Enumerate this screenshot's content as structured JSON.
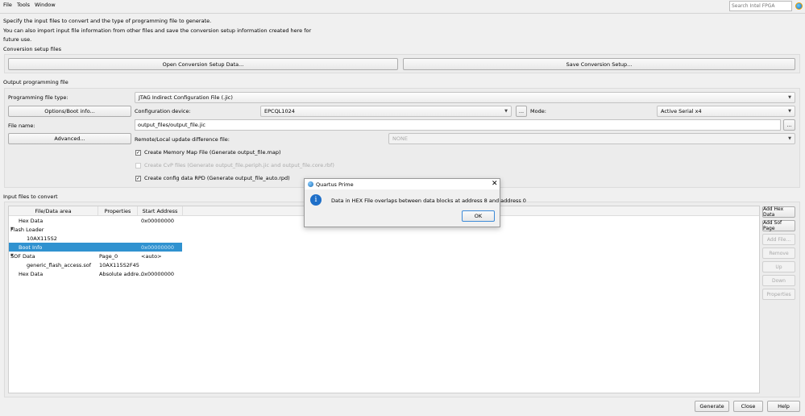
{
  "menu": [
    "File",
    "Tools",
    "Window"
  ],
  "search": {
    "placeholder": "Search Intel FPGA"
  },
  "intro": [
    "Specify the input files to convert and the type of programming file to generate.",
    "You can also import input file information from other files and save the conversion setup information created here for",
    "future use."
  ],
  "conversion_setup": {
    "title": "Conversion setup files",
    "open_label": "Open Conversion Setup Data...",
    "save_label": "Save Conversion Setup..."
  },
  "output": {
    "title": "Output programming file",
    "type_label": "Programming file type:",
    "type_value": "JTAG Indirect Configuration File (.jic)",
    "options_label": "Options/Boot info...",
    "device_label": "Configuration device:",
    "device_value": "EPCQL1024",
    "browse_label": "...",
    "mode_label": "Mode:",
    "mode_value": "Active Serial x4",
    "file_label": "File name:",
    "file_value": "output_files/output_file.jic",
    "advanced_label": "Advanced...",
    "remote_label": "Remote/Local update difference file:",
    "remote_value": "NONE",
    "checks": [
      {
        "label": "Create Memory Map File (Generate output_file.map)",
        "checked": true,
        "enabled": true
      },
      {
        "label": "Create CvP files (Generate output_file.periph.jic and output_file.core.rbf)",
        "checked": false,
        "enabled": false
      },
      {
        "label": "Create config data RPD (Generate output_file_auto.rpd)",
        "checked": true,
        "enabled": true
      }
    ]
  },
  "input": {
    "title": "Input files to convert",
    "columns": [
      "File/Data area",
      "Properties",
      "Start Address"
    ],
    "rows": [
      {
        "name": "Hex Data",
        "props": "",
        "addr": "0x00000000",
        "indent": 1
      },
      {
        "name": "Flash Loader",
        "props": "",
        "addr": "",
        "indent": 0,
        "expanded": true
      },
      {
        "name": "10AX115S2",
        "props": "",
        "addr": "",
        "indent": 2
      },
      {
        "name": "Boot Info",
        "props": "",
        "addr": "0x00000000",
        "indent": 1,
        "selected": true
      },
      {
        "name": "SOF Data",
        "props": "Page_0",
        "addr": "<auto>",
        "indent": 0,
        "expanded": true
      },
      {
        "name": "generic_flash_access.sof",
        "props": "10AX115S2F45",
        "addr": "",
        "indent": 2
      },
      {
        "name": "Hex Data",
        "props": "Absolute addre...",
        "addr": "0x00000000",
        "indent": 1
      }
    ],
    "buttons": [
      {
        "label": "Add Hex Data",
        "enabled": true
      },
      {
        "label": "Add Sof Page",
        "enabled": true
      },
      {
        "label": "Add File...",
        "enabled": false
      },
      {
        "label": "Remove",
        "enabled": false
      },
      {
        "label": "Up",
        "enabled": false
      },
      {
        "label": "Down",
        "enabled": false
      },
      {
        "label": "Properties",
        "enabled": false
      }
    ]
  },
  "footer": {
    "generate": "Generate",
    "close": "Close",
    "help": "Help"
  },
  "dialog": {
    "title": "Quartus Prime",
    "message": "Data in HEX File overlaps between data blocks at address 8 and address 0",
    "ok": "OK"
  }
}
